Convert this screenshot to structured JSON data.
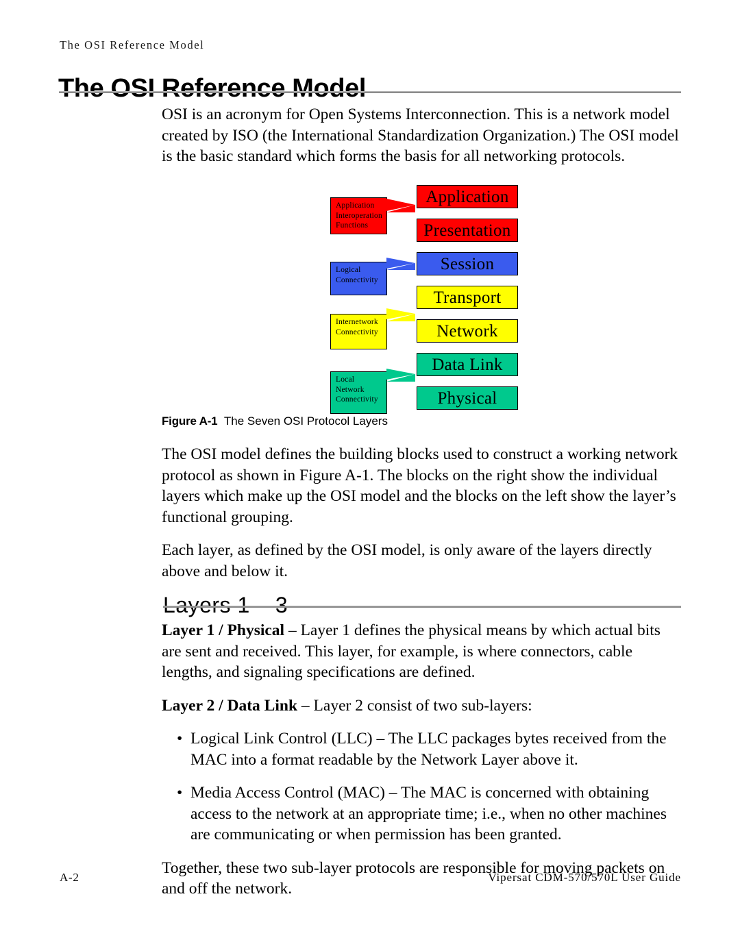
{
  "header": {
    "running_title": "The OSI Reference Model",
    "chapter_title": "The OSI Reference Model"
  },
  "intro_paragraph": "OSI is an acronym for Open Systems Interconnection. This is a network model created by ISO (the International Standardization Organization.) The OSI model is the basic standard which forms the basis for all networking protocols.",
  "figure": {
    "label": "Figure A-1",
    "caption": "The Seven OSI Protocol Layers",
    "colors": {
      "red": "#FF0000",
      "blue": "#3A5BEE",
      "yellow": "#FFFF00",
      "green": "#00C98D",
      "border": "#000000"
    },
    "layers": [
      {
        "name": "Application",
        "color": "#FF0000"
      },
      {
        "name": "Presentation",
        "color": "#FF0000"
      },
      {
        "name": "Session",
        "color": "#3A5BEE"
      },
      {
        "name": "Transport",
        "color": "#FFFF00"
      },
      {
        "name": "Network",
        "color": "#FFFF00"
      },
      {
        "name": "Data Link",
        "color": "#00C98D"
      },
      {
        "name": "Physical",
        "color": "#00C98D"
      }
    ],
    "groupings": [
      {
        "lines": [
          "Application",
          "Interoperation",
          "Functions"
        ],
        "color": "#FF0000"
      },
      {
        "lines": [
          "Logical",
          "Connectivity"
        ],
        "color": "#3A5BEE"
      },
      {
        "lines": [
          "Internetwork",
          "Connectivity"
        ],
        "color": "#FFFF00"
      },
      {
        "lines": [
          "Local",
          "Network",
          "Connectivity"
        ],
        "color": "#00C98D"
      }
    ]
  },
  "paragraph_after_figure": "The OSI model defines the building blocks used to construct a working network protocol as shown in Figure A-1. The blocks on the right show the individual layers which make up the OSI model and the blocks on the left show the layer’s functional grouping.",
  "paragraph_each_layer": "Each layer, as defined by the OSI model, is only aware of the layers directly above and below it.",
  "section": {
    "heading": "Layers 1 – 3",
    "layer1": {
      "lead": "Layer 1 / Physical",
      "rest": " – Layer 1 defines the physical means by which actual bits are sent and received. This layer, for example, is where connectors, cable lengths, and signaling specifications are defined."
    },
    "layer2": {
      "lead": "Layer 2 / Data Link",
      "rest": " – Layer 2 consist of two sub-layers:"
    },
    "bullets": [
      {
        "marker": "•",
        "text": "Logical Link Control (LLC) – The LLC packages bytes received from the MAC into a format readable by the Network Layer above it."
      },
      {
        "marker": "•",
        "text": "Media Access Control (MAC) – The MAC is concerned with obtaining access to the network at an appropriate time; i.e., when no other machines are communicating or when permission has been granted."
      }
    ],
    "closing_paragraph": "Together, these two sub-layer protocols are responsible for moving packets on and off the network."
  },
  "footer": {
    "page_number": "A-2",
    "guide_title": "Vipersat CDM-570/570L User Guide"
  }
}
